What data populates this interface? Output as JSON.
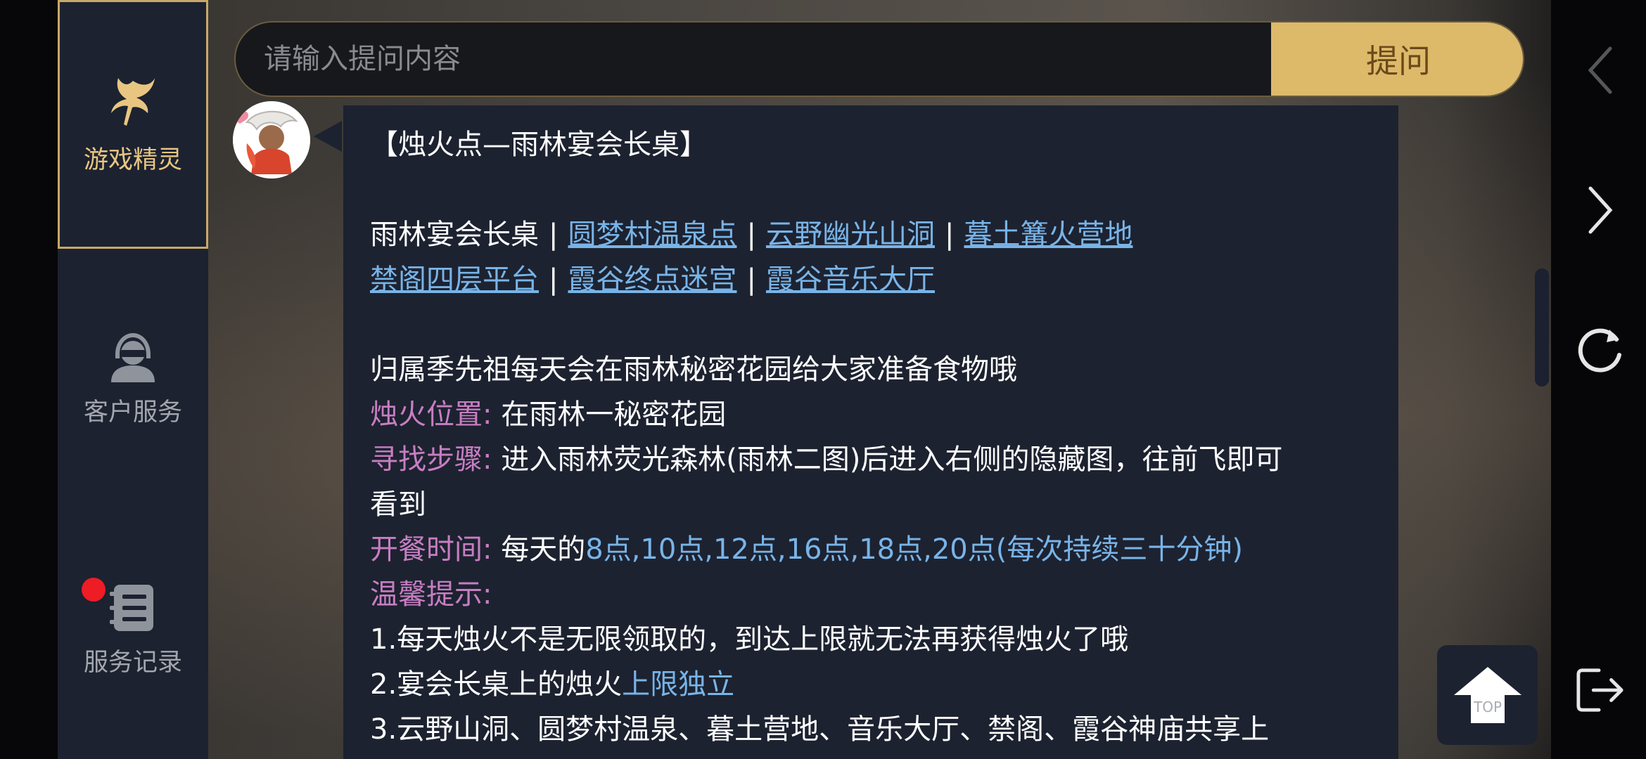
{
  "sidebar": {
    "tabs": [
      {
        "label": "游戏精灵",
        "icon": "fairy-icon",
        "active": true
      },
      {
        "label": "客户服务",
        "icon": "customer-service-icon",
        "active": false
      },
      {
        "label": "服务记录",
        "icon": "records-icon",
        "active": false,
        "badge": true
      }
    ]
  },
  "question": {
    "placeholder": "请输入提问内容",
    "value": "",
    "button_label": "提问"
  },
  "answer": {
    "title": "【烛火点—雨林宴会长桌】",
    "locations_line1": {
      "current": "雨林宴会长桌",
      "separator": "|",
      "links": [
        "圆梦村温泉点",
        "云野幽光山洞",
        "暮土篝火营地"
      ]
    },
    "locations_line2": {
      "links": [
        "禁阁四层平台",
        "霞谷终点迷宫",
        "霞谷音乐大厅"
      ]
    },
    "intro": "归属季先祖每天会在雨林秘密花园给大家准备食物哦",
    "position_label": "烛火位置:",
    "position_value": "在雨林一秘密花园",
    "steps_label": "寻找步骤:",
    "steps_value_line1": "进入雨林荧光森林(雨林二图)后进入右侧的隐藏图，往前飞即可",
    "steps_value_line2": "看到",
    "time_label": "开餐时间:",
    "time_prefix": "每天的",
    "time_value": "8点,10点,12点,16点,18点,20点(每次持续三十分钟)",
    "tips_label": "温馨提示:",
    "tip1": "1.每天烛火不是无限领取的，到达上限就无法再获得烛火了哦",
    "tip2_prefix": "2.宴会长桌上的烛火",
    "tip2_highlight": "上限独立",
    "tip3": "3.云野山洞、圆梦村温泉、暮土营地、音乐大厅、禁阁、霞谷神庙共享上"
  },
  "top_button": {
    "label": "TOP"
  },
  "nav": {
    "icons": [
      "back-icon",
      "forward-icon",
      "refresh-icon",
      "exit-icon"
    ]
  },
  "colors": {
    "accent_gold": "#ddb96a",
    "link_blue": "#78b4e8",
    "label_pink": "#c77ec2",
    "card_bg": "#1d2230",
    "badge_red": "#ee1c25"
  }
}
